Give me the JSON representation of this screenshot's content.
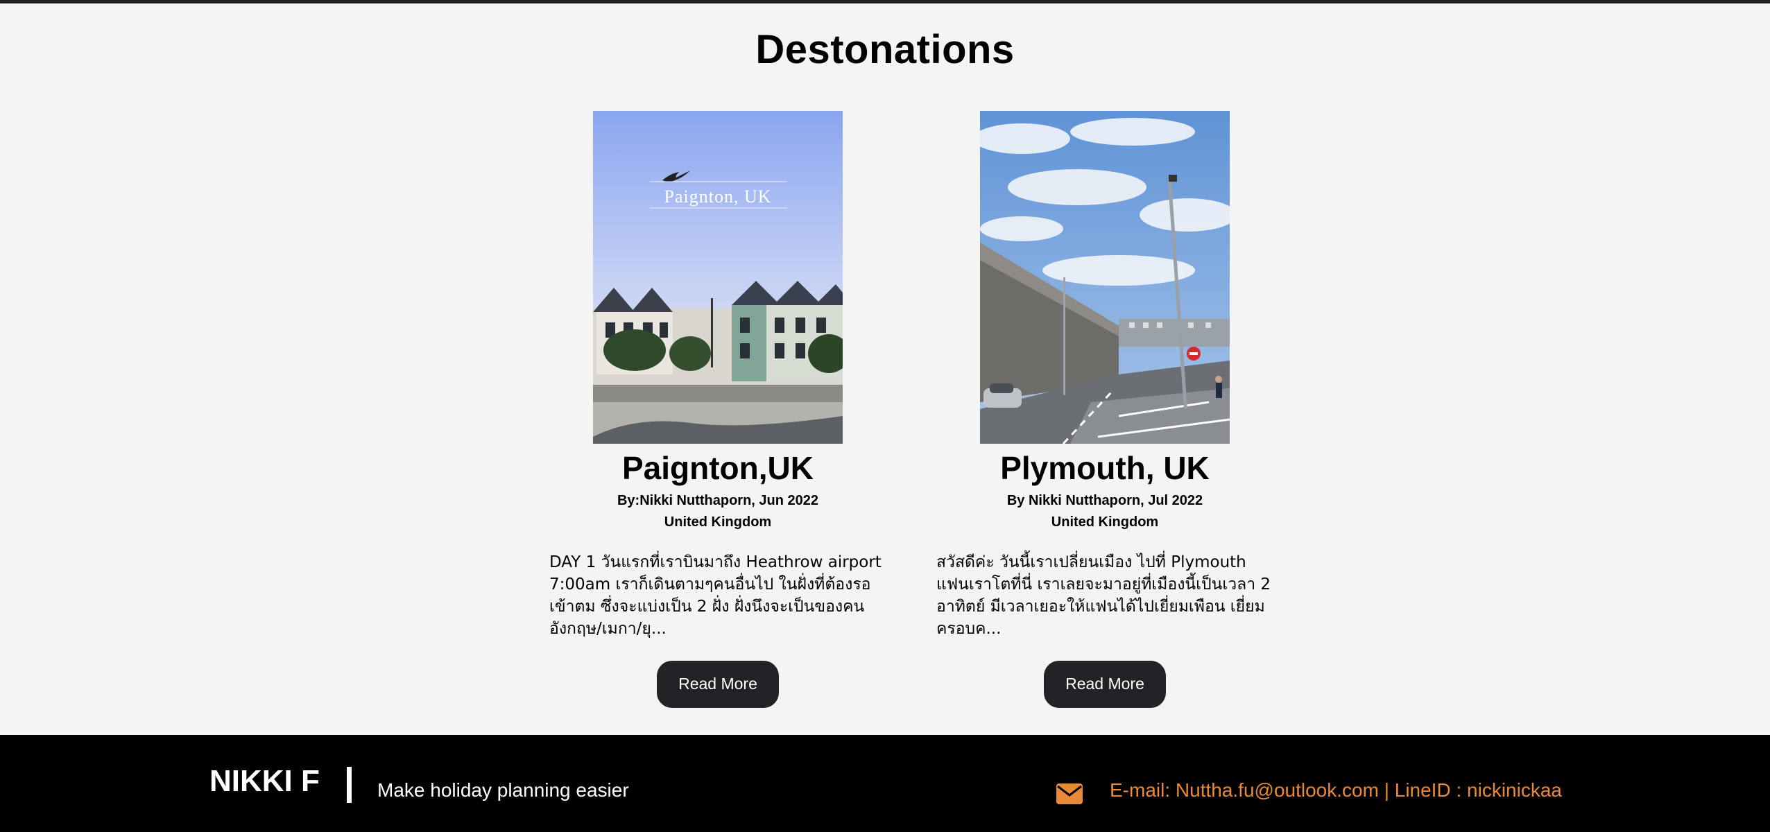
{
  "page": {
    "title": "Destonations"
  },
  "cards": [
    {
      "photo_caption": "Paignton, UK",
      "title": "Paignton,UK",
      "byline": "By:Nikki Nutthaporn, Jun 2022",
      "country": "United Kingdom",
      "excerpt": "DAY 1 วันแรกที่เราบินมาถึง Heathrow airport 7:00am เราก็เดินตามๆคนอื่นไป ในฝั่งที่ต้องรอเข้าตม ซึ่งจะแบ่งเป็น 2 ฝั่ง ฝั่งนึงจะเป็นของคนอังกฤษ/เมกา/ยุ...",
      "button_label": "Read More"
    },
    {
      "title": "Plymouth, UK",
      "byline": "By Nikki Nutthaporn, Jul 2022",
      "country": "United Kingdom",
      "excerpt": "สวัสดีค่ะ วันนี้เราเปลี่ยนเมือง ไปที่ Plymouth แฟนเราโตที่นี่ เราเลยจะมาอยู่ที่เมืองนี้เป็นเวลา 2 อาทิตย์ มีเวลาเยอะให้แฟนได้ไปเยี่ยมเพือน เยี่ยมครอบค...",
      "button_label": "Read More"
    }
  ],
  "footer": {
    "brand": "NIKKI F",
    "tagline": "Make holiday planning easier",
    "contact": "E-mail: Nuttha.fu@outlook.com | LineID : nickinickaa",
    "icon": "mail-icon",
    "contact_color": "#e8893a"
  }
}
